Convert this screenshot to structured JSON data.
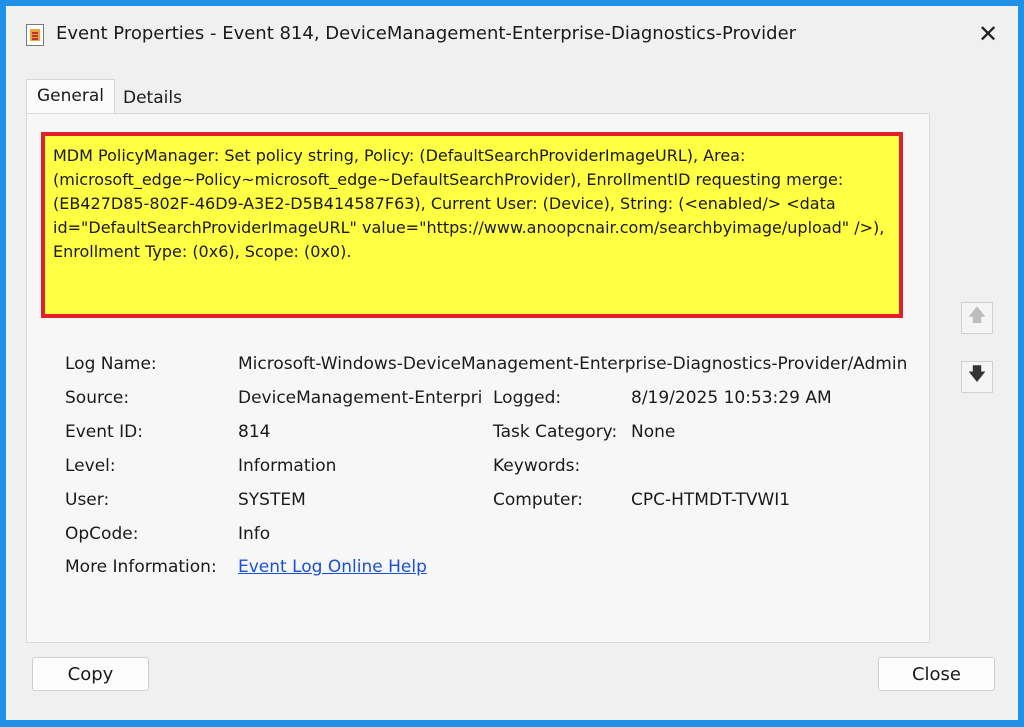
{
  "window": {
    "title": "Event Properties - Event 814, DeviceManagement-Enterprise-Diagnostics-Provider",
    "close_glyph": "✕"
  },
  "tabs": [
    {
      "label": "General",
      "active": true
    },
    {
      "label": "Details",
      "active": false
    }
  ],
  "description": "MDM PolicyManager: Set policy string, Policy: (DefaultSearchProviderImageURL), Area: (microsoft_edge~Policy~microsoft_edge~DefaultSearchProvider), EnrollmentID requesting merge: (EB427D85-802F-46D9-A3E2-D5B414587F63), Current User: (Device), String: (<enabled/> <data id=\"DefaultSearchProviderImageURL\" value=\"https://www.anoopcnair.com/searchbyimage/upload\" />), Enrollment Type: (0x6), Scope: (0x0).",
  "fields": {
    "log_name": {
      "label": "Log Name:",
      "value": "Microsoft-Windows-DeviceManagement-Enterprise-Diagnostics-Provider/Admin"
    },
    "source": {
      "label": "Source:",
      "value": "DeviceManagement-Enterpri"
    },
    "logged": {
      "label": "Logged:",
      "value": "8/19/2025 10:53:29 AM"
    },
    "event_id": {
      "label": "Event ID:",
      "value": "814"
    },
    "task_category": {
      "label": "Task Category:",
      "value": "None"
    },
    "level": {
      "label": "Level:",
      "value": "Information"
    },
    "keywords": {
      "label": "Keywords:",
      "value": ""
    },
    "user": {
      "label": "User:",
      "value": "SYSTEM"
    },
    "computer": {
      "label": "Computer:",
      "value": "CPC-HTMDT-TVWI1"
    },
    "opcode": {
      "label": "OpCode:",
      "value": "Info"
    },
    "more_info": {
      "label": "More Information:",
      "link_text": "Event Log Online Help"
    }
  },
  "buttons": {
    "copy": "Copy",
    "close": "Close",
    "up_glyph": "🡅",
    "down_glyph": "🡇"
  },
  "colors": {
    "highlight": "#ffff44",
    "highlight_border": "#e0202a",
    "link": "#1a4fd8",
    "desktop": "#1e90e6"
  }
}
